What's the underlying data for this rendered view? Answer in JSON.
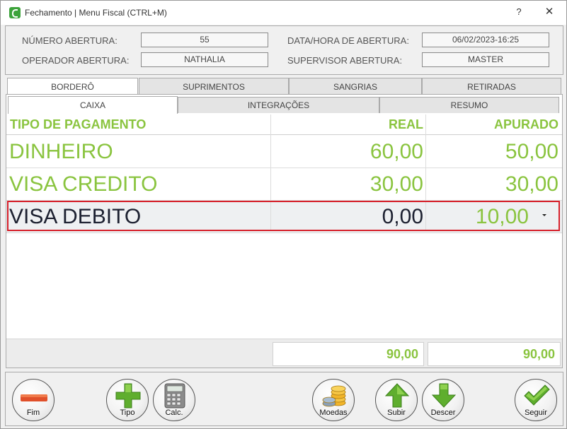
{
  "window": {
    "title": "Fechamento | Menu Fiscal (CTRL+M)",
    "help": "?",
    "close": "✕"
  },
  "header": {
    "numero_abertura": {
      "label": "NÚMERO ABERTURA:",
      "value": "55"
    },
    "data_hora_abertura": {
      "label": "DATA/HORA DE ABERTURA:",
      "value": "06/02/2023-16:25"
    },
    "operador_abertura": {
      "label": "OPERADOR ABERTURA:",
      "value": "NATHALIA"
    },
    "supervisor_abertura": {
      "label": "SUPERVISOR ABERTURA:",
      "value": "MASTER"
    }
  },
  "tabs_row1": [
    "BORDERÔ",
    "SUPRIMENTOS",
    "SANGRIAS",
    "RETIRADAS"
  ],
  "tabs_row2": [
    "CAIXA",
    "INTEGRAÇÕES",
    "RESUMO"
  ],
  "table": {
    "columns": [
      "TIPO DE PAGAMENTO",
      "REAL",
      "APURADO"
    ],
    "rows": [
      {
        "tipo": "DINHEIRO",
        "real": "60,00",
        "apurado": "50,00"
      },
      {
        "tipo": "VISA CREDITO",
        "real": "30,00",
        "apurado": "30,00"
      },
      {
        "tipo": "VISA DEBITO",
        "real": "0,00",
        "apurado": "10,00"
      }
    ],
    "selected_row": 2,
    "totals": {
      "real": "90,00",
      "apurado": "90,00"
    }
  },
  "toolbar": {
    "fim": "Fim",
    "tipo": "Tipo",
    "calc": "Calc.",
    "moedas": "Moedas",
    "subir": "Subir",
    "descer": "Descer",
    "seguir": "Seguir"
  },
  "colors": {
    "accent_green": "#8ac43f",
    "selection_border": "#d6202a",
    "fim_red": "#e0502a"
  }
}
